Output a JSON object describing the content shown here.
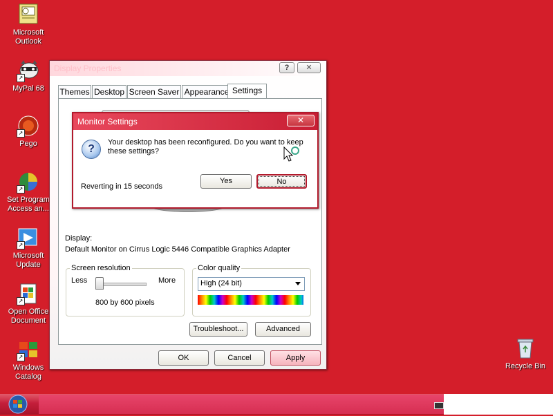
{
  "desktop": {
    "icons": [
      {
        "label_line1": "Microsoft",
        "label_line2": "Outlook"
      },
      {
        "label_line1": "MyPal 68",
        "label_line2": ""
      },
      {
        "label_line1": "Pego",
        "label_line2": ""
      },
      {
        "label_line1": "Set Program",
        "label_line2": "Access an..."
      },
      {
        "label_line1": "Microsoft",
        "label_line2": "Update"
      },
      {
        "label_line1": "Open Office",
        "label_line2": "Document"
      },
      {
        "label_line1": "Windows",
        "label_line2": "Catalog"
      }
    ],
    "recycle_bin_label": "Recycle Bin",
    "background_color": "#d41e2a"
  },
  "display_properties": {
    "title": "Display Properties",
    "tabs": [
      "Themes",
      "Desktop",
      "Screen Saver",
      "Appearance",
      "Settings"
    ],
    "active_tab": "Settings",
    "display_label": "Display:",
    "display_value": "Default Monitor on Cirrus Logic 5446 Compatible Graphics Adapter",
    "screen_resolution": {
      "legend": "Screen resolution",
      "less": "Less",
      "more": "More",
      "value_text": "800 by 600 pixels"
    },
    "color_quality": {
      "legend": "Color quality",
      "selected": "High (24 bit)"
    },
    "troubleshoot_label": "Troubleshoot...",
    "advanced_label": "Advanced",
    "ok_label": "OK",
    "cancel_label": "Cancel",
    "apply_label": "Apply"
  },
  "monitor_settings": {
    "title": "Monitor Settings",
    "message": "Your desktop has been reconfigured.  Do you want to keep these settings?",
    "countdown": "Reverting in 15 seconds",
    "yes_label": "Yes",
    "no_label": "No"
  },
  "icons": {
    "help": "question-icon",
    "close": "close-icon"
  }
}
